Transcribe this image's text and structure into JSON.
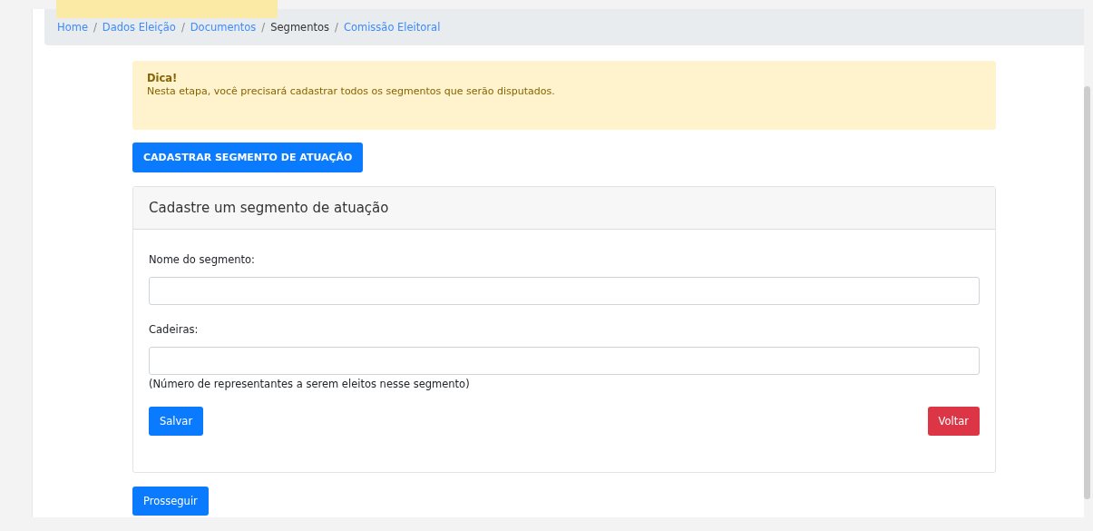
{
  "breadcrumb": {
    "items": [
      {
        "label": "Home",
        "selected": false
      },
      {
        "label": "Dados Eleição",
        "selected": false,
        "separator": "/"
      },
      {
        "label": "Documentos",
        "selected": false,
        "separator": "/"
      },
      {
        "label": "Segmentos",
        "selected": true,
        "separator": "/"
      },
      {
        "label": "Comissão Eleitoral",
        "selected": false,
        "separator": "/"
      }
    ]
  },
  "alert": {
    "title": "Dica!",
    "text": "Nesta etapa, você precisará cadastrar todos os segmentos que serão disputados."
  },
  "register_button": "CADASTRAR SEGMENTO DE ATUAÇÃO",
  "card": {
    "title": "Cadastre um segmento de atuação",
    "fields": [
      {
        "label": "Nome do segmento:"
      },
      {
        "label": "Cadeiras:",
        "help": "(Número de representantes a serem eleitos nesse segmento)"
      }
    ],
    "save_button": "Salvar",
    "back_button": "Voltar"
  },
  "continue_button": "Prosseguir"
}
